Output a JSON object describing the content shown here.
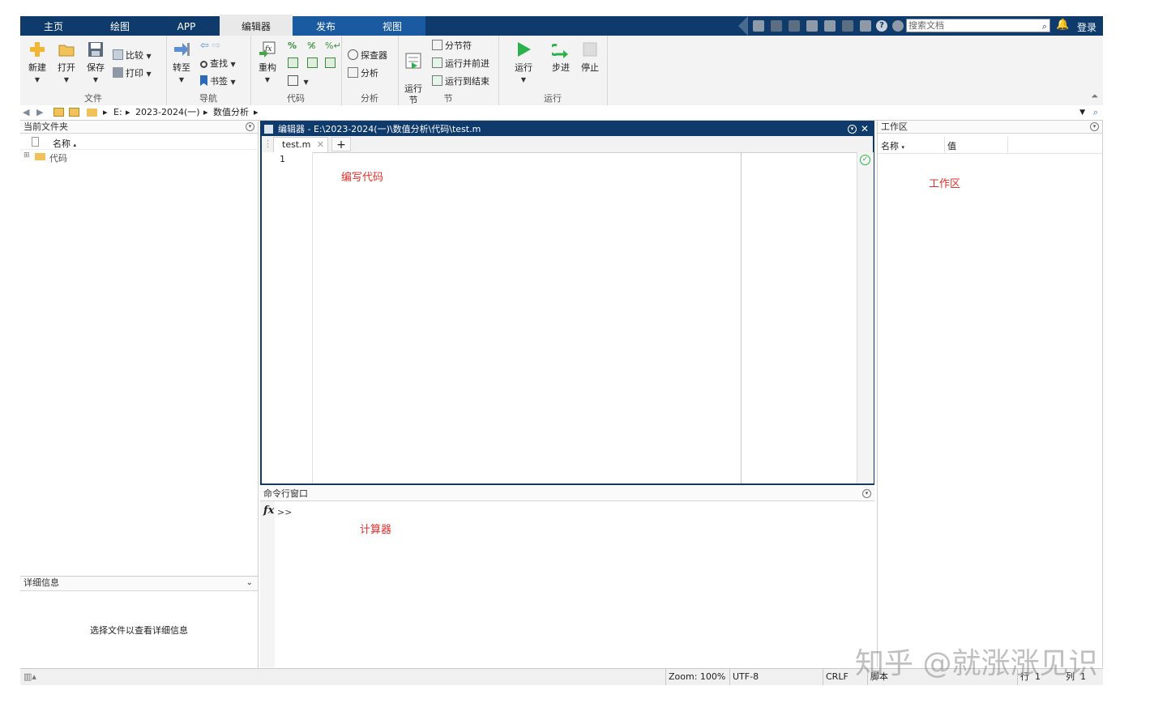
{
  "tabs": [
    "主页",
    "绘图",
    "APP",
    "编辑器",
    "发布",
    "视图"
  ],
  "active_tab": "编辑器",
  "search": {
    "placeholder": "搜索文档"
  },
  "login_label": "登录",
  "ribbon": {
    "file": {
      "label": "文件",
      "new": "新建",
      "open": "打开",
      "save": "保存",
      "compare": "比较",
      "print": "打印"
    },
    "nav": {
      "label": "导航",
      "goto": "转至",
      "find": "查找",
      "bookmark": "书签"
    },
    "code": {
      "label": "代码",
      "refactor": "重构"
    },
    "analyze": {
      "label": "分析",
      "profiler": "探查器",
      "analyze": "分析"
    },
    "section": {
      "label": "节",
      "run_section": "运行\n节",
      "section_break": "分节符",
      "run_advance": "运行并前进",
      "run_to_end": "运行到结束"
    },
    "run": {
      "label": "运行",
      "run": "运行",
      "step": "步进",
      "stop": "停止"
    }
  },
  "address": {
    "parts": [
      "E:",
      "2023-2024(一)",
      "数值分析"
    ]
  },
  "current_folder": {
    "title": "当前文件夹",
    "col_name": "名称",
    "items": [
      "代码"
    ]
  },
  "details": {
    "title": "详细信息",
    "message": "选择文件以查看详细信息"
  },
  "editor": {
    "title": "编辑器 - E:\\2023-2024(一)\\数值分析\\代码\\test.m",
    "file_tab": "test.m",
    "line_number": "1",
    "annotation": "编写代码"
  },
  "command_window": {
    "title": "命令行窗口",
    "fx": "fx",
    "prompt": ">>",
    "annotation": "计算器"
  },
  "workspace": {
    "title": "工作区",
    "col_name": "名称",
    "col_value": "值",
    "annotation": "工作区"
  },
  "status": {
    "zoom": "Zoom: 100%",
    "encoding": "UTF-8",
    "eol": "CRLF",
    "type": "脚本",
    "row_label": "行",
    "row": "1",
    "col_label": "列",
    "col": "1"
  },
  "watermark": "知乎 @就涨涨见识",
  "colors": {
    "title_bar": "#0e3a6c",
    "accent_red": "#e0302a",
    "run_green": "#2bb24c"
  }
}
